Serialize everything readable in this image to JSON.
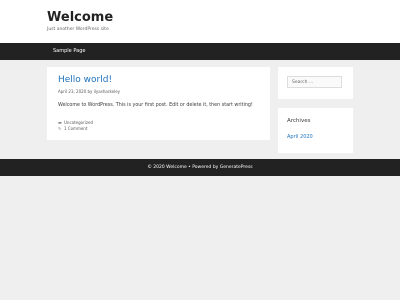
{
  "site": {
    "title": "Welcome",
    "description": "Just another WordPress site"
  },
  "nav": {
    "items": [
      {
        "label": "Sample Page"
      }
    ]
  },
  "post": {
    "title": "Hello world!",
    "date": "April 23, 2020",
    "by_word": "by",
    "author": "ilyasharkeley",
    "content": "Welcome to WordPress. This is your first post. Edit or delete it, then start writing!",
    "category": "Uncategorized",
    "comments": "1 Comment",
    "category_icon": "folder-icon",
    "comment_icon": "comment-icon"
  },
  "sidebar": {
    "search_placeholder": "Search ...",
    "archives_title": "Archives",
    "archives": [
      {
        "label": "April 2020"
      }
    ]
  },
  "footer": {
    "copyright": "© 2020 Welcome • Powered by GeneratePress"
  },
  "colors": {
    "link": "#1e73be",
    "nav_bg": "#222222",
    "page_bg": "#efefef"
  }
}
